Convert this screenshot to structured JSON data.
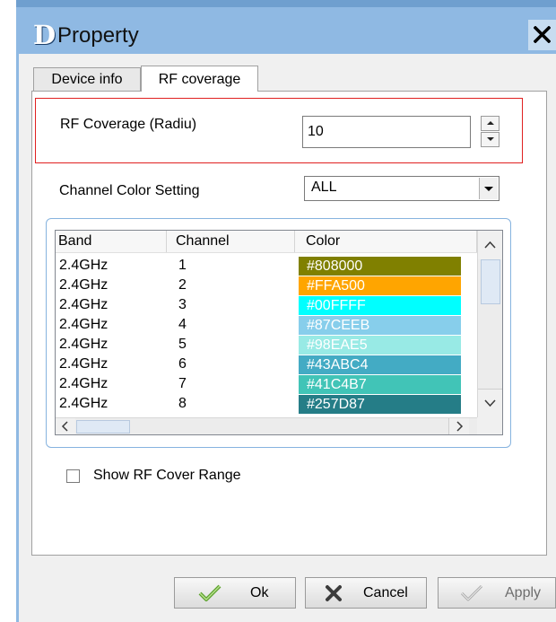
{
  "window": {
    "title": "Property",
    "logo_letter": "D"
  },
  "tabs": [
    {
      "label": "Device info",
      "active": false
    },
    {
      "label": "RF coverage",
      "active": true
    }
  ],
  "rf_coverage": {
    "label": "RF Coverage (Radiu)",
    "value": "10"
  },
  "channel_color_setting": {
    "label": "Channel Color Setting",
    "selected": "ALL"
  },
  "table": {
    "columns": [
      "Band",
      "Channel",
      "Color"
    ],
    "rows": [
      {
        "band": "2.4GHz",
        "channel": "1",
        "color": "#808000"
      },
      {
        "band": "2.4GHz",
        "channel": "2",
        "color": "#FFA500"
      },
      {
        "band": "2.4GHz",
        "channel": "3",
        "color": "#00FFFF"
      },
      {
        "band": "2.4GHz",
        "channel": "4",
        "color": "#87CEEB"
      },
      {
        "band": "2.4GHz",
        "channel": "5",
        "color": "#98EAE5"
      },
      {
        "band": "2.4GHz",
        "channel": "6",
        "color": "#43ABC4"
      },
      {
        "band": "2.4GHz",
        "channel": "7",
        "color": "#41C4B7"
      },
      {
        "band": "2.4GHz",
        "channel": "8",
        "color": "#257D87"
      }
    ]
  },
  "show_rf_cover_range": {
    "label": "Show RF Cover Range",
    "checked": false
  },
  "buttons": {
    "ok": "Ok",
    "cancel": "Cancel",
    "apply": "Apply"
  }
}
